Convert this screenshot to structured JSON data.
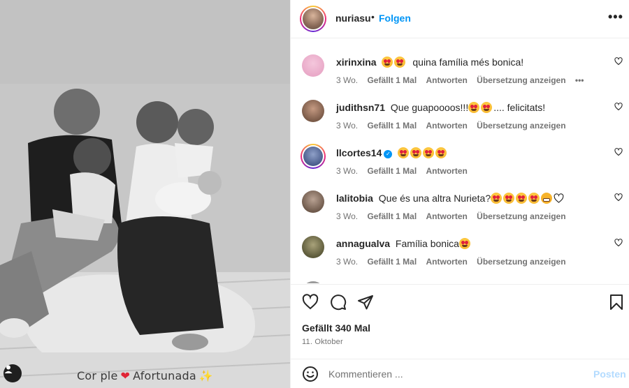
{
  "post": {
    "username": "nuriasu",
    "separator": "•",
    "follow_label": "Folgen",
    "more_label": "•••",
    "caption": {
      "text_before": "Cor ple",
      "text_after": "Afortunada"
    }
  },
  "comments": [
    {
      "username": "xirinxina",
      "text": "quina família més bonica!",
      "age": "3 Wo.",
      "likes": "Gefällt 1 Mal",
      "reply": "Antworten",
      "translate": "Übersetzung anzeigen",
      "more": "•••",
      "avatar_color": "#e9a9c8"
    },
    {
      "username": "judithsn71",
      "text": "Que guapoooos!!!",
      "text_suffix": ".... felicitats!",
      "age": "3 Wo.",
      "likes": "Gefällt 1 Mal",
      "reply": "Antworten",
      "translate": "Übersetzung anzeigen",
      "avatar_color": "#7a5a48"
    },
    {
      "username": "llcortes14",
      "text": "",
      "age": "3 Wo.",
      "likes": "Gefällt 1 Mal",
      "reply": "Antworten",
      "avatar_color": "#4a5d8c"
    },
    {
      "username": "lalitobia",
      "text": "Que és una altra Nurieta?",
      "age": "3 Wo.",
      "likes": "Gefällt 1 Mal",
      "reply": "Antworten",
      "translate": "Übersetzung anzeigen",
      "avatar_color": "#6f5a4c"
    },
    {
      "username": "annagualva",
      "text": "Família bonica",
      "age": "3 Wo.",
      "likes": "Gefällt 1 Mal",
      "reply": "Antworten",
      "translate": "Übersetzung anzeigen",
      "avatar_color": "#5c5a3a"
    }
  ],
  "engagement": {
    "likes_label": "Gefällt 340 Mal",
    "date_label": "11. Oktober"
  },
  "composer": {
    "placeholder": "Kommentieren ...",
    "post_label": "Posten"
  },
  "colors": {
    "link_blue": "#0095f6",
    "post_disabled": "#b3dbff",
    "heart_red": "#e02435"
  },
  "icons": [
    "smiley-icon",
    "heart-outline-icon",
    "comment-icon",
    "share-icon",
    "bookmark-icon",
    "user-tag-icon",
    "verified-badge-icon"
  ]
}
